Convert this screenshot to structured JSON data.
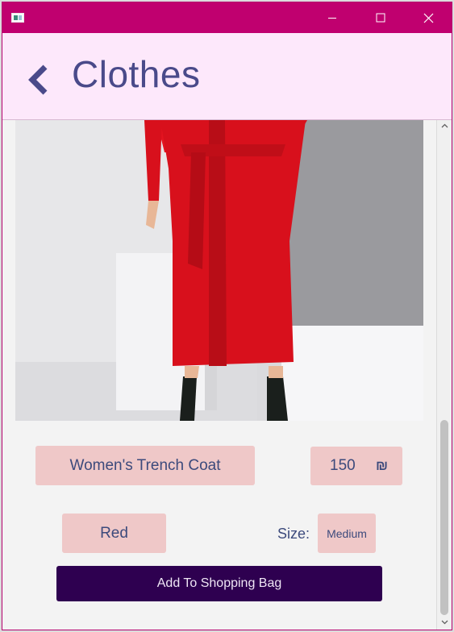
{
  "window": {
    "controls": {
      "minimize": "minimize-icon",
      "maximize": "maximize-icon",
      "close": "close-icon"
    }
  },
  "header": {
    "title": "Clothes",
    "back_icon": "chevron-left-icon"
  },
  "product": {
    "name": "Women's Trench Coat",
    "price": "150",
    "currency_symbol": "₪",
    "color": "Red",
    "size_label": "Size:",
    "size": "Medium",
    "add_button_label": "Add To Shopping Bag"
  },
  "colors": {
    "titlebar": "#c0006f",
    "header_bg": "#fde8fb",
    "field_bg": "#efc8c8",
    "text": "#3c4a7c",
    "button_bg": "#2e0050"
  }
}
